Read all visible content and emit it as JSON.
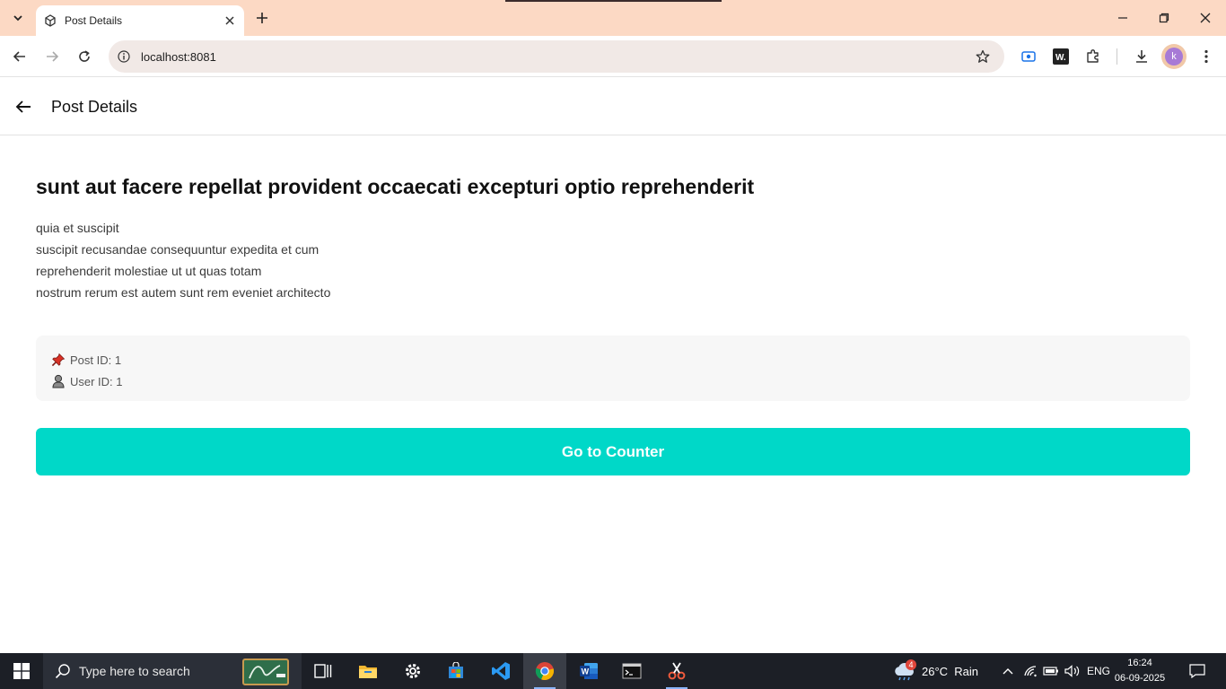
{
  "browser": {
    "tab_title": "Post Details",
    "url": "localhost:8081",
    "profile_initial": "k"
  },
  "app": {
    "title": "Post Details"
  },
  "post": {
    "title": "sunt aut facere repellat provident occaecati excepturi optio reprehenderit",
    "body_lines": [
      "quia et suscipit",
      "suscipit recusandae consequuntur expedita et cum",
      "reprehenderit molestiae ut ut quas totam",
      "nostrum rerum est autem sunt rem eveniet architecto"
    ],
    "post_id_label": "Post ID: 1",
    "user_id_label": "User ID: 1"
  },
  "actions": {
    "counter_button": "Go to Counter"
  },
  "taskbar": {
    "search_placeholder": "Type here to search",
    "weather": "26°C  Rain",
    "weather_badge": "4",
    "language": "ENG",
    "time": "16:24",
    "date": "06-09-2025"
  },
  "colors": {
    "accent": "#00d8c8",
    "tabstrip": "#fcd9c4",
    "taskbar": "#1c1f26"
  }
}
